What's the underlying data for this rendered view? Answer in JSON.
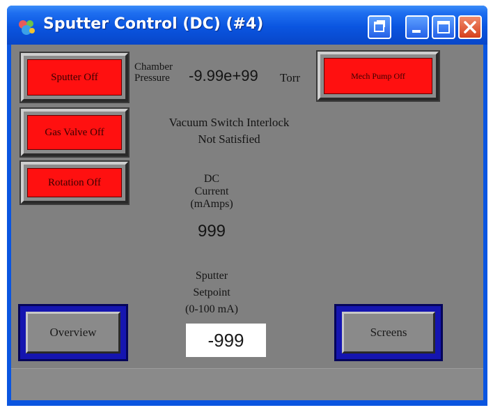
{
  "window": {
    "title": "Sputter Control (DC) (#4)",
    "colors": {
      "titlebar": "#0a55e0",
      "panel": "#808080",
      "off": "#ff1010",
      "nav_border": "#1515b0"
    }
  },
  "buttons": {
    "sputter": "Sputter Off",
    "gas_valve": "Gas Valve Off",
    "rotation": "Rotation Off",
    "mech_pump": "Mech Pump Off",
    "overview": "Overview",
    "screens": "Screens"
  },
  "pressure": {
    "label_line1": "Chamber",
    "label_line2": "Pressure",
    "value": "-9.99e+99",
    "unit": "Torr"
  },
  "interlock": {
    "line1": "Vacuum Switch Interlock",
    "line2": "Not Satisfied"
  },
  "current": {
    "line1": "DC",
    "line2": "Current",
    "line3": "(mAmps)",
    "value": "999"
  },
  "setpoint": {
    "line1": "Sputter",
    "line2": "Setpoint",
    "line3": "(0-100 mA)",
    "value": "-999"
  }
}
